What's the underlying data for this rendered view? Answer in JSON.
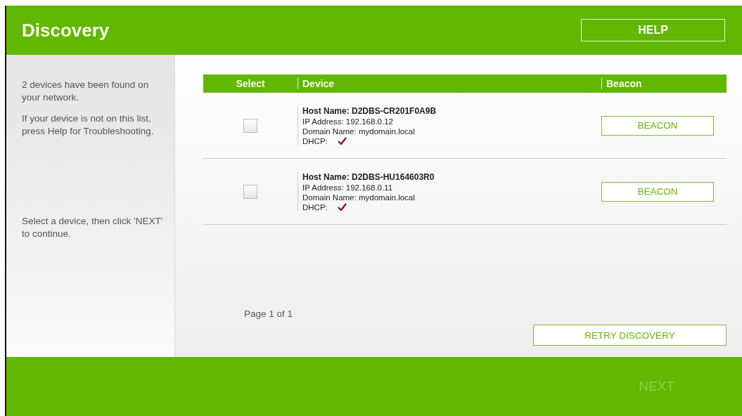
{
  "header": {
    "title": "Discovery",
    "help_button": "HELP"
  },
  "sidebar": {
    "paragraphs": [
      "2 devices have been found on your network.",
      "If your device is not on this list, press Help for Troubleshooting.",
      "Select a device, then click 'NEXT' to continue."
    ]
  },
  "table": {
    "columns": [
      "Select",
      "Device",
      "Beacon"
    ],
    "rows": [
      {
        "selected": false,
        "host_label": "Host Name:",
        "host_name": "D2DBS-CR201F0A9B",
        "fields": [
          {
            "label": "IP Address:",
            "value": "192.168.0.12"
          },
          {
            "label": "Domain Name:",
            "value": "mydomain.local"
          }
        ],
        "dhcp": {
          "label": "DHCP:",
          "checked": true
        },
        "beacon_button": "BEACON"
      },
      {
        "selected": false,
        "host_label": "Host Name:",
        "host_name": "D2DBS-HU164603R0",
        "fields": [
          {
            "label": "IP Address:",
            "value": "192.168.0.11"
          },
          {
            "label": "Domain Name:",
            "value": "mydomain.local"
          }
        ],
        "dhcp": {
          "label": "DHCP:",
          "checked": true
        },
        "beacon_button": "BEACON"
      }
    ]
  },
  "pagination": "Page 1 of 1",
  "retry_button": "RETRY DISCOVERY",
  "next_button": {
    "label": "NEXT",
    "disabled": true
  }
}
